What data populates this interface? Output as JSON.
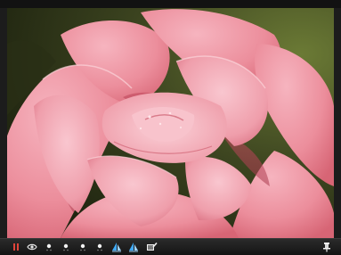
{
  "viewer": {
    "image_subject": "pink-rose-photo",
    "accent_color": "#e0443a",
    "toolbar": {
      "buttons": [
        {
          "icon": "pause-icon",
          "name": "pause-button"
        },
        {
          "icon": "eye-icon",
          "name": "view-button"
        },
        {
          "icon": "dot-icon",
          "name": "point-tool-1"
        },
        {
          "icon": "dot-icon",
          "name": "point-tool-2"
        },
        {
          "icon": "dot-icon",
          "name": "point-tool-3"
        },
        {
          "icon": "dot-icon",
          "name": "point-tool-4"
        },
        {
          "icon": "sail-icon",
          "name": "sail-tool-1"
        },
        {
          "icon": "sail-icon",
          "name": "sail-tool-2"
        },
        {
          "icon": "image-pen-icon",
          "name": "image-edit-button"
        },
        {
          "icon": "pin-icon",
          "name": "pin-button"
        }
      ]
    }
  }
}
